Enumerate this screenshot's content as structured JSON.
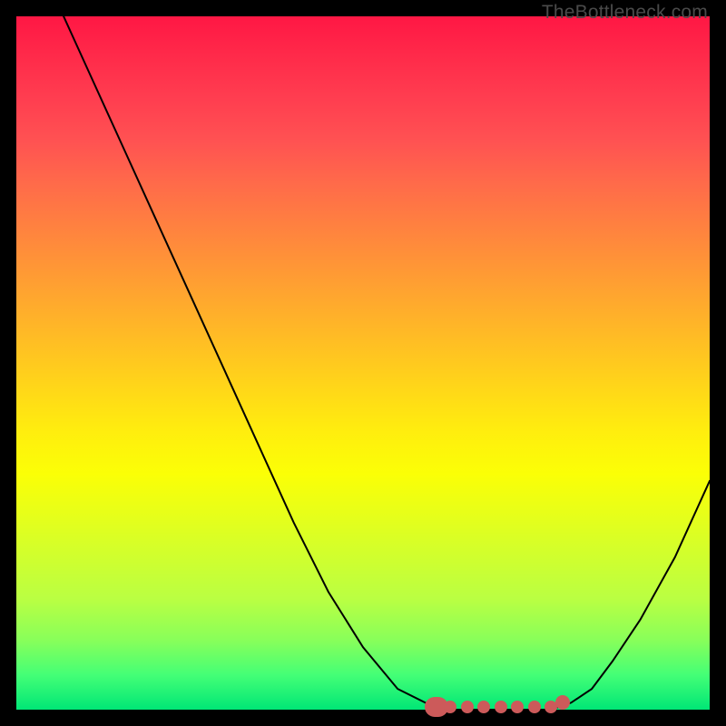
{
  "watermark": "TheBottleneck.com",
  "colors": {
    "frame": "#000000",
    "marker": "#cc5a5a",
    "curve": "#000000"
  },
  "chart_data": {
    "type": "line",
    "title": "",
    "xlabel": "",
    "ylabel": "",
    "xlim": [
      0,
      100
    ],
    "ylim": [
      0,
      100
    ],
    "grid": false,
    "legend": false,
    "series": [
      {
        "name": "bottleneck-curve",
        "x": [
          0,
          5,
          10,
          15,
          20,
          25,
          30,
          35,
          40,
          45,
          50,
          55,
          60,
          63,
          66,
          70,
          74,
          77,
          80,
          83,
          86,
          90,
          95,
          100
        ],
        "y": [
          115,
          104,
          93,
          82,
          71,
          60,
          49,
          38,
          27,
          17,
          9,
          3,
          0.5,
          0,
          0,
          0,
          0,
          0,
          1,
          3,
          7,
          13,
          22,
          33
        ]
      }
    ],
    "annotations": [
      {
        "name": "optimal-range-markers",
        "x_start": 60,
        "x_end": 77,
        "y": 0,
        "style": "thick-dots"
      }
    ],
    "background_gradient": {
      "top": "#ff1744",
      "middle": "#ffee0e",
      "bottom": "#00e676",
      "meaning": "bottleneck severity (red high, green low)"
    }
  }
}
